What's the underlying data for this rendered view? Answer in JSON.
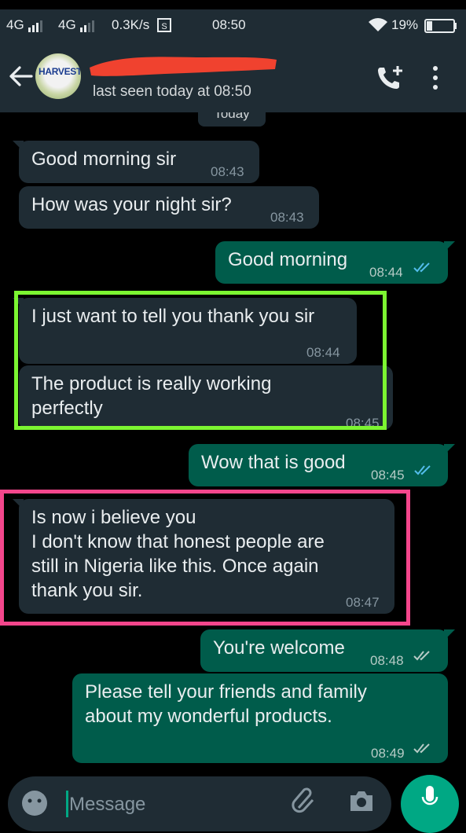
{
  "status_bar": {
    "network1": "4G",
    "network2": "4G",
    "speed": "0.3K/s",
    "time": "08:50",
    "battery": "19%"
  },
  "header": {
    "avatar_text": "HARVEST",
    "last_seen": "last seen today at 08:50",
    "icons": [
      "back-arrow-icon",
      "call-add-icon",
      "more-vert-icon"
    ]
  },
  "chat": {
    "date_chip": "Today",
    "messages": [
      {
        "dir": "in",
        "lines": [
          "Good morning sir"
        ],
        "time": "08:43"
      },
      {
        "dir": "in",
        "lines": [
          "How was your night sir?"
        ],
        "time": "08:43"
      },
      {
        "dir": "out",
        "lines": [
          "Good morning"
        ],
        "time": "08:44",
        "ticks": "read"
      },
      {
        "dir": "in",
        "lines": [
          "I just want to tell you thank you sir"
        ],
        "time": "08:44"
      },
      {
        "dir": "in",
        "lines": [
          "The product is really working",
          "perfectly"
        ],
        "time": "08:45"
      },
      {
        "dir": "out",
        "lines": [
          "Wow that is good"
        ],
        "time": "08:45",
        "ticks": "read"
      },
      {
        "dir": "in",
        "lines": [
          "Is now i believe you",
          "I don't know that honest people are",
          "still in Nigeria like this. Once again",
          "thank you sir."
        ],
        "time": "08:47"
      },
      {
        "dir": "out",
        "lines": [
          "You're welcome"
        ],
        "time": "08:48",
        "ticks": "delivered"
      },
      {
        "dir": "out",
        "lines": [
          "Please tell your friends and family",
          "about my wonderful products."
        ],
        "time": "08:49",
        "ticks": "delivered"
      }
    ]
  },
  "composer": {
    "placeholder": "Message"
  },
  "colors": {
    "header_bg": "#1f2c34",
    "incoming_bubble": "#1f2c34",
    "outgoing_bubble": "#005c4b",
    "read_tick": "#53bdeb",
    "highlight_green": "#7cf531",
    "highlight_pink": "#f4468c",
    "redaction": "#f0422f"
  }
}
